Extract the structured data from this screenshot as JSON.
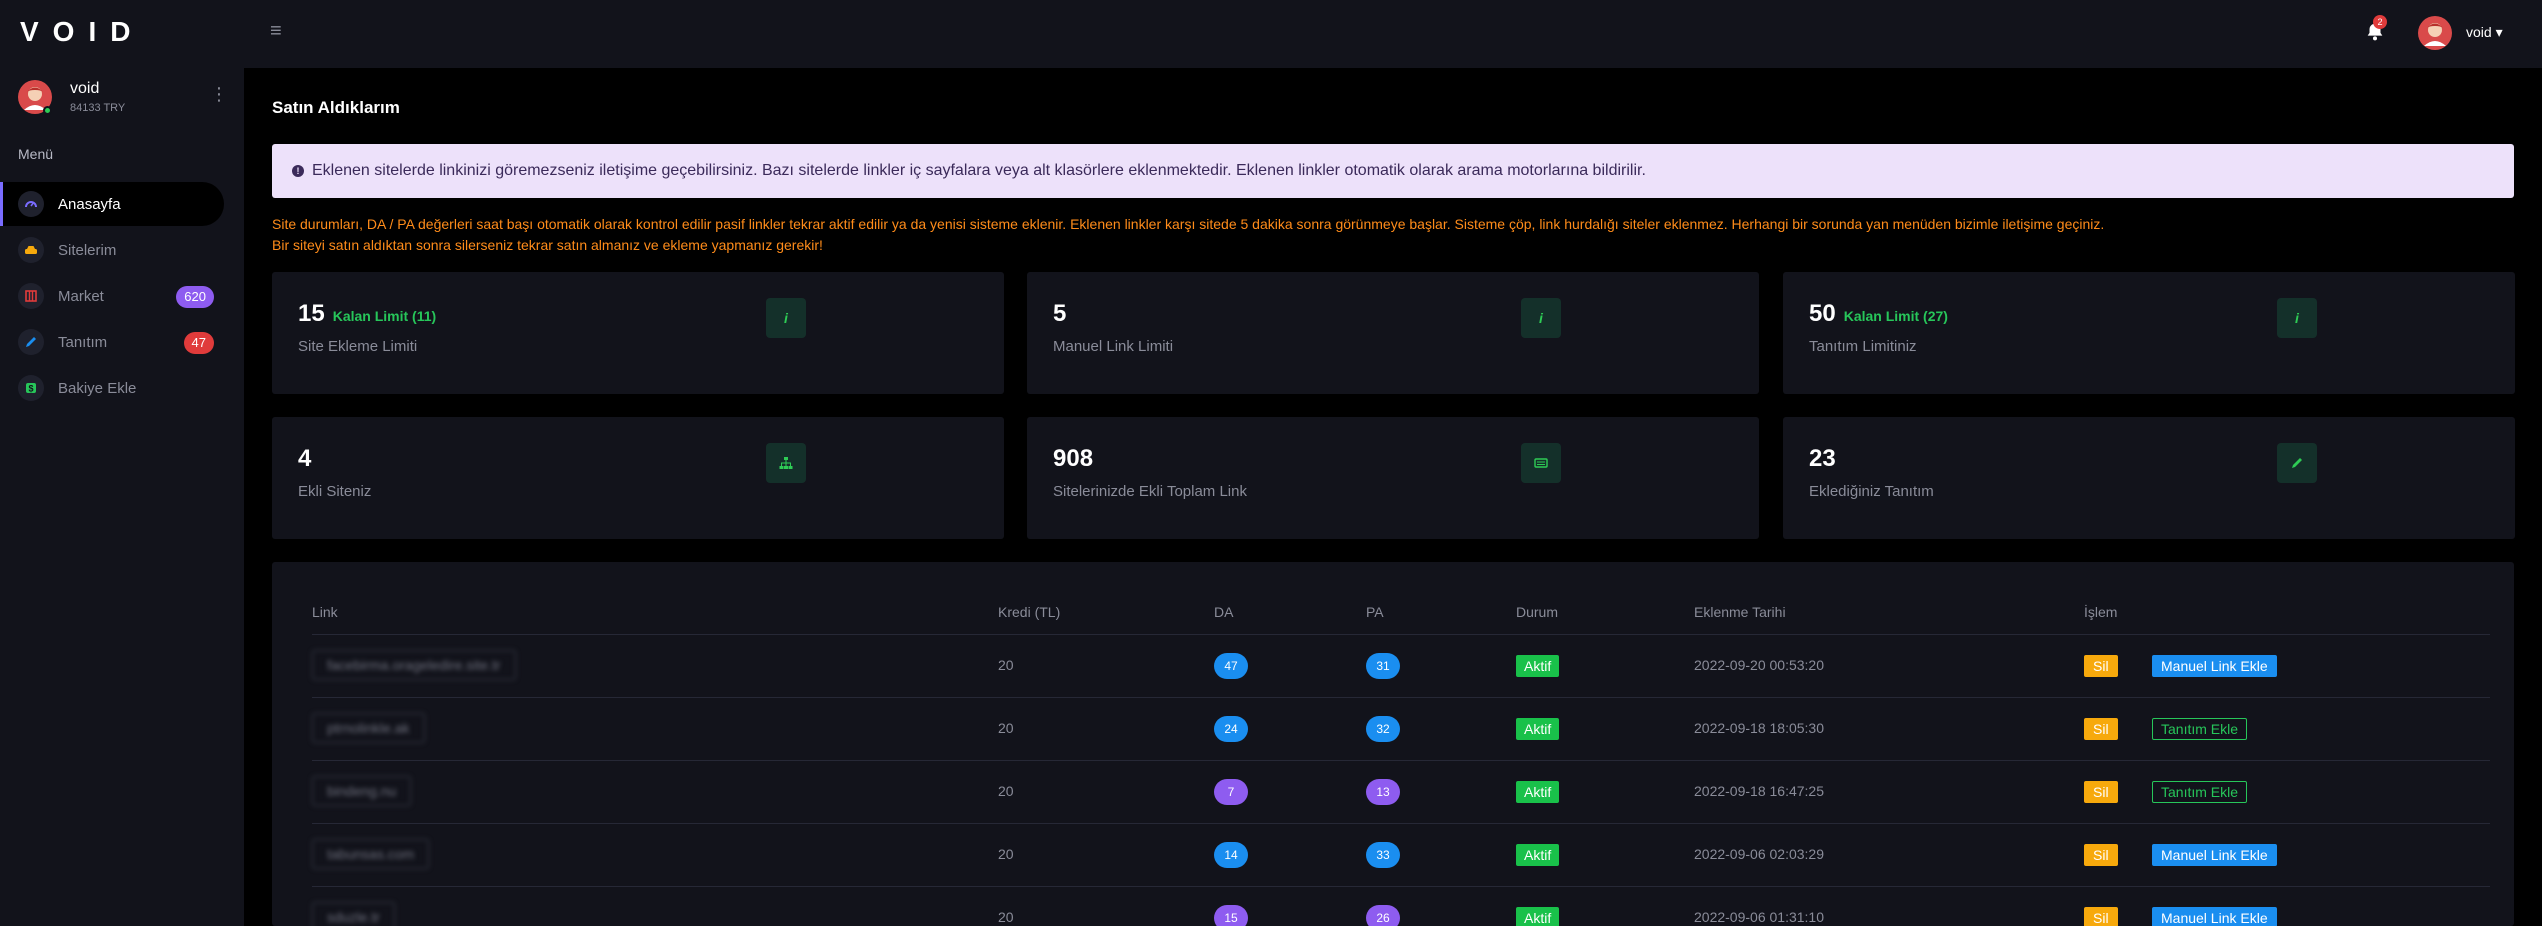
{
  "app": {
    "logo": "VOID"
  },
  "topbar": {
    "notification_count": "2",
    "username": "void ▾"
  },
  "sidebar": {
    "user": {
      "name": "void",
      "balance": "84133 TRY"
    },
    "menu_heading": "Menü",
    "items": [
      {
        "label": "Anasayfa",
        "icon": "gauge-icon",
        "color": "#7a6cff",
        "badge": ""
      },
      {
        "label": "Sitelerim",
        "icon": "car-icon",
        "color": "#f7a90c",
        "badge": ""
      },
      {
        "label": "Market",
        "icon": "store-icon",
        "color": "#e03b3b",
        "badge": "620"
      },
      {
        "label": "Tanıtım",
        "icon": "pen-icon",
        "color": "#1a8ef0",
        "badge": "47"
      },
      {
        "label": "Bakiye Ekle",
        "icon": "dollar-icon",
        "color": "#27c65a",
        "badge": ""
      }
    ],
    "badge_colors": {
      "market": "#8e5cf0",
      "tanitim": "#e03b3b"
    }
  },
  "page": {
    "title": "Satın Aldıklarım",
    "alert": "Eklenen sitelerde linkinizi göremezseniz iletişime geçebilirsiniz. Bazı sitelerde linkler iç sayfalara veya alt klasörlere eklenmektedir. Eklenen linkler otomatik olarak arama motorlarına bildirilir.",
    "notice_line1": "Site durumları, DA / PA değerleri saat başı otomatik olarak kontrol edilir pasif linkler tekrar aktif edilir ya da yenisi sisteme eklenir. Eklenen linkler karşı sitede 5 dakika sonra görünmeye başlar. Sisteme çöp, link hurdalığı siteler eklenmez. Herhangi bir sorunda yan menüden bizimle iletişime geçiniz.",
    "notice_line2": "Bir siteyi satın aldıktan sonra silerseniz tekrar satın almanız ve ekleme yapmanız gerekir!"
  },
  "cards": [
    {
      "value": "15",
      "extra": "Kalan Limit (11)",
      "label": "Site Ekleme Limiti",
      "icon": "info-icon"
    },
    {
      "value": "5",
      "extra": "",
      "label": "Manuel Link Limiti",
      "icon": "info-icon"
    },
    {
      "value": "50",
      "extra": "Kalan Limit (27)",
      "label": "Tanıtım Limitiniz",
      "icon": "info-icon"
    },
    {
      "value": "4",
      "extra": "",
      "label": "Ekli Siteniz",
      "icon": "sitemap-icon"
    },
    {
      "value": "908",
      "extra": "",
      "label": "Sitelerinizde Ekli Toplam Link",
      "icon": "link-list-icon"
    },
    {
      "value": "23",
      "extra": "",
      "label": "Eklediğiniz Tanıtım",
      "icon": "pen-icon"
    }
  ],
  "table": {
    "columns": [
      "Link",
      "Kredi (TL)",
      "DA",
      "PA",
      "Durum",
      "Eklenme Tarihi",
      "İşlem"
    ],
    "delete_label": "Sil",
    "rows": [
      {
        "link": "facebirma.orageledire.site.tr",
        "kredi": "20",
        "da": "47",
        "pa": "31",
        "durum": "Aktif",
        "tarih": "2022-09-20 00:53:20",
        "action": "Manuel Link Ekle"
      },
      {
        "link": "ptrnolinkle.ak",
        "kredi": "20",
        "da": "24",
        "pa": "32",
        "durum": "Aktif",
        "tarih": "2022-09-18 18:05:30",
        "action": "Tanıtım Ekle"
      },
      {
        "link": "bindeng.nu",
        "kredi": "20",
        "da": "7",
        "pa": "13",
        "durum": "Aktif",
        "tarih": "2022-09-18 16:47:25",
        "action": "Tanıtım Ekle"
      },
      {
        "link": "tabunsas.com",
        "kredi": "20",
        "da": "14",
        "pa": "33",
        "durum": "Aktif",
        "tarih": "2022-09-06 02:03:29",
        "action": "Manuel Link Ekle"
      },
      {
        "link": "sduzle.tr",
        "kredi": "20",
        "da": "15",
        "pa": "26",
        "durum": "Aktif",
        "tarih": "2022-09-06 01:31:10",
        "action": "Manuel Link Ekle"
      }
    ],
    "pill_colors": {
      "blue": "#1a8ef0",
      "purple": "#8e5cf0"
    }
  }
}
